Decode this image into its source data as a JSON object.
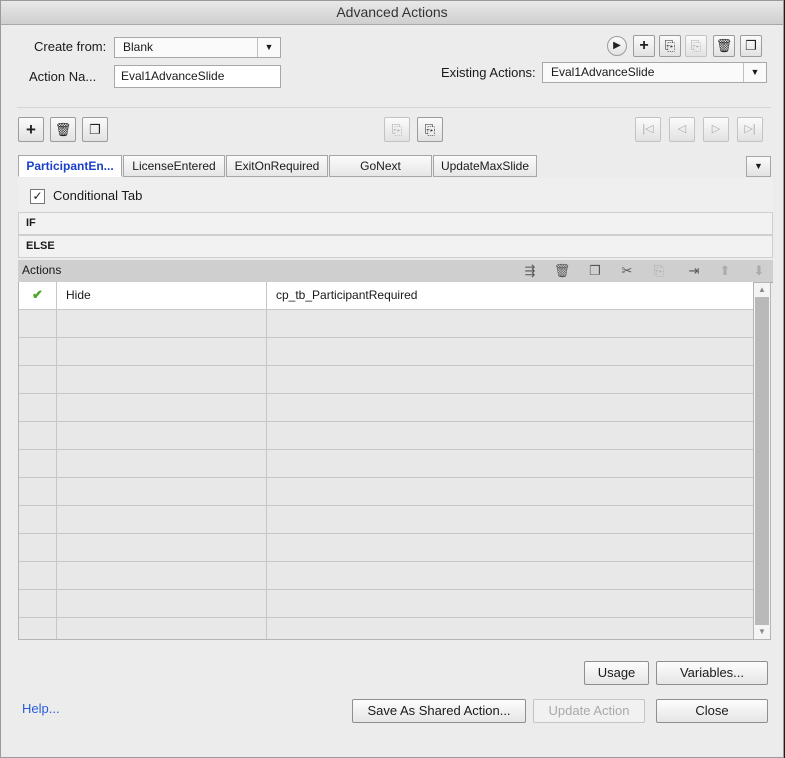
{
  "window": {
    "title": "Advanced Actions"
  },
  "form": {
    "create_from_label": "Create from:",
    "create_from_value": "Blank",
    "action_name_label": "Action Na...",
    "action_name_value": "Eval1AdvanceSlide",
    "existing_actions_label": "Existing Actions:",
    "existing_actions_value": "Eval1AdvanceSlide"
  },
  "top_toolbar_icons": [
    "preview-icon",
    "add-icon",
    "import-icon",
    "export-icon",
    "delete-icon",
    "duplicate-icon"
  ],
  "tabs": [
    {
      "label": "ParticipantEn...",
      "active": true
    },
    {
      "label": "LicenseEntered",
      "active": false
    },
    {
      "label": "ExitOnRequired",
      "active": false
    },
    {
      "label": "GoNext",
      "active": false
    },
    {
      "label": "UpdateMaxSlide",
      "active": false
    }
  ],
  "conditional": {
    "label": "Conditional Tab",
    "checked": true,
    "check_glyph": "✓"
  },
  "if_label": "IF",
  "else_label": "ELSE",
  "actions": {
    "header_label": "Actions",
    "rows": [
      {
        "status": "✔",
        "action": "Hide",
        "target": "cp_tb_ParticipantRequired"
      }
    ],
    "empty_rows": 12
  },
  "buttons": {
    "usage": "Usage",
    "variables": "Variables...",
    "help": "Help...",
    "save_shared": "Save As Shared Action...",
    "update_action": "Update Action",
    "close": "Close"
  },
  "colors": {
    "active_tab": "#1b41c8",
    "check": "#4da52a",
    "help_link": "#2a5bd7"
  }
}
